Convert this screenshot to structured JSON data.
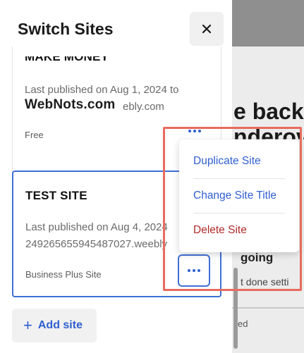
{
  "panel": {
    "title": "Switch Sites",
    "close_icon": "close-icon"
  },
  "sites": [
    {
      "title": "MAKE MONEY",
      "published": "Last published on Aug 1, 2024 to",
      "url_suffix": "ebly.com",
      "watermark": "WebNots.com",
      "plan": "Free"
    },
    {
      "title": "TEST SITE",
      "published": "Last published on Aug 4, 2024",
      "url": "2492656559454870​27.weebly",
      "plan": "Business Plus Site"
    }
  ],
  "add_site": {
    "label": "Add site",
    "icon": "plus-icon"
  },
  "menu": {
    "items": [
      "Duplicate Site",
      "Change Site Title",
      "Delete Site"
    ]
  },
  "background": {
    "headline_line1": "e back",
    "headline_line2": "nderov",
    "sub": "going",
    "sub2": "t done setti",
    "sub3": "ed"
  },
  "colors": {
    "accent": "#2f5fcf",
    "danger": "#b02a2a",
    "highlight": "#e86b5e",
    "selected_border": "#3f6fd6"
  }
}
